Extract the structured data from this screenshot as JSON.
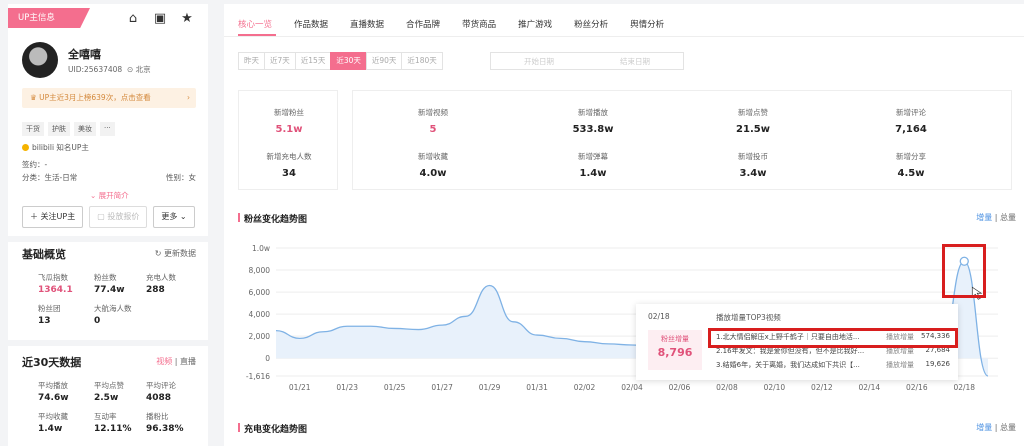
{
  "sidebar": {
    "badge": "UP主信息",
    "icons": [
      "home-icon",
      "video-icon",
      "star-icon"
    ],
    "name": "全嘻嘻",
    "uid": "UID:25637408",
    "location": "北京",
    "promo": "UP主近3月上榜639次，点击查看",
    "tags": [
      "干货",
      "护肤",
      "美妆",
      "···"
    ],
    "platform": "bilibili 知名UP主",
    "signature_label": "签约：",
    "signature_value": "-",
    "category_label": "分类：",
    "category_value": "生活-日常",
    "gender_label": "性别：",
    "gender_value": "女",
    "expand": "展开简介",
    "follow_btn": "＋ 关注UP主",
    "report_btn": "投放报价",
    "more_btn": "更多",
    "basic_title": "基础概览",
    "refresh": "更新数据",
    "basic_stats": [
      {
        "label": "飞瓜指数",
        "value": "1364.1",
        "pink": true
      },
      {
        "label": "粉丝数",
        "value": "77.4w"
      },
      {
        "label": "充电人数",
        "value": "288"
      },
      {
        "label": "粉丝团",
        "value": "13"
      },
      {
        "label": "大航海人数",
        "value": "0"
      }
    ],
    "recent_title": "近30天数据",
    "recent_tab_video": "视频",
    "recent_tab_live": "直播",
    "recent_stats": [
      {
        "label": "平均播放",
        "value": "74.6w"
      },
      {
        "label": "平均点赞",
        "value": "2.5w"
      },
      {
        "label": "平均评论",
        "value": "4088"
      },
      {
        "label": "平均收藏",
        "value": "1.4w"
      },
      {
        "label": "互动率",
        "value": "12.11%"
      },
      {
        "label": "播粉比",
        "value": "96.38%"
      }
    ]
  },
  "main": {
    "tabs": [
      "核心一览",
      "作品数据",
      "直播数据",
      "合作品牌",
      "带货商品",
      "推广游戏",
      "粉丝分析",
      "舆情分析"
    ],
    "ranges": [
      "昨天",
      "近7天",
      "近15天",
      "近30天",
      "近90天",
      "近180天"
    ],
    "active_range": 3,
    "date_start": "开始日期",
    "date_end": "结束日期",
    "card1": [
      {
        "label": "新增粉丝",
        "value": "5.1w",
        "pink": true
      },
      {
        "label": "新增充电人数",
        "value": "34"
      }
    ],
    "card2": [
      {
        "label": "新增视频",
        "value": "5",
        "pink": true
      },
      {
        "label": "新增播放",
        "value": "533.8w"
      },
      {
        "label": "新增点赞",
        "value": "21.5w"
      },
      {
        "label": "新增评论",
        "value": "7,164"
      },
      {
        "label": "新增收藏",
        "value": "4.0w"
      },
      {
        "label": "新增弹幕",
        "value": "1.4w"
      },
      {
        "label": "新增投币",
        "value": "3.4w"
      },
      {
        "label": "新增分享",
        "value": "4.5w"
      }
    ],
    "fan_chart_title": "粉丝变化趋势图",
    "toggle_add": "增量",
    "toggle_total": "总量",
    "charge_chart_title": "充电变化趋势图"
  },
  "tooltip": {
    "date": "02/18",
    "header": "播放增量TOP3视频",
    "box_label": "粉丝增量",
    "box_value": "8,796",
    "metric_label": "播放增量",
    "rows": [
      {
        "title": "1.北大情侣解压x上野千鹤子｜只要自由地活...",
        "value": "574,336"
      },
      {
        "title": "2.16年发文：我是爱你但没有，但不是比我好...",
        "value": "27,684"
      },
      {
        "title": "3.结婚6年，关于离婚，我们达成如下共识【...",
        "value": "19,626"
      }
    ]
  },
  "chart_data": {
    "type": "line",
    "title": "粉丝变化趋势图",
    "x_tick_labels": [
      "01/21",
      "01/23",
      "01/25",
      "01/27",
      "01/29",
      "01/31",
      "02/02",
      "02/04",
      "02/06",
      "02/08",
      "02/10",
      "02/12",
      "02/14",
      "02/16",
      "02/18"
    ],
    "y_tick_labels": [
      "1.0w",
      "8,000",
      "6,000",
      "4,000",
      "2,000",
      "0",
      "-1,616"
    ],
    "ylim": [
      -1616,
      10000
    ],
    "x": [
      "01/20",
      "01/21",
      "01/22",
      "01/23",
      "01/24",
      "01/25",
      "01/26",
      "01/27",
      "01/28",
      "01/29",
      "01/30",
      "01/31",
      "02/01",
      "02/02",
      "02/03",
      "02/04",
      "02/05",
      "02/06",
      "02/07",
      "02/08",
      "02/09",
      "02/10",
      "02/11",
      "02/12",
      "02/13",
      "02/14",
      "02/15",
      "02/16",
      "02/17",
      "02/18",
      "02/19"
    ],
    "series": [
      {
        "values": [
          2500,
          1800,
          2400,
          2900,
          2900,
          2700,
          2600,
          3000,
          3800,
          6600,
          3300,
          2100,
          1800,
          1500,
          1300,
          1200,
          1000,
          900,
          900,
          900,
          800,
          800,
          800,
          700,
          700,
          700,
          600,
          600,
          500,
          8796,
          -1616
        ]
      }
    ],
    "grid": true,
    "highlighted_point": "02/18"
  }
}
